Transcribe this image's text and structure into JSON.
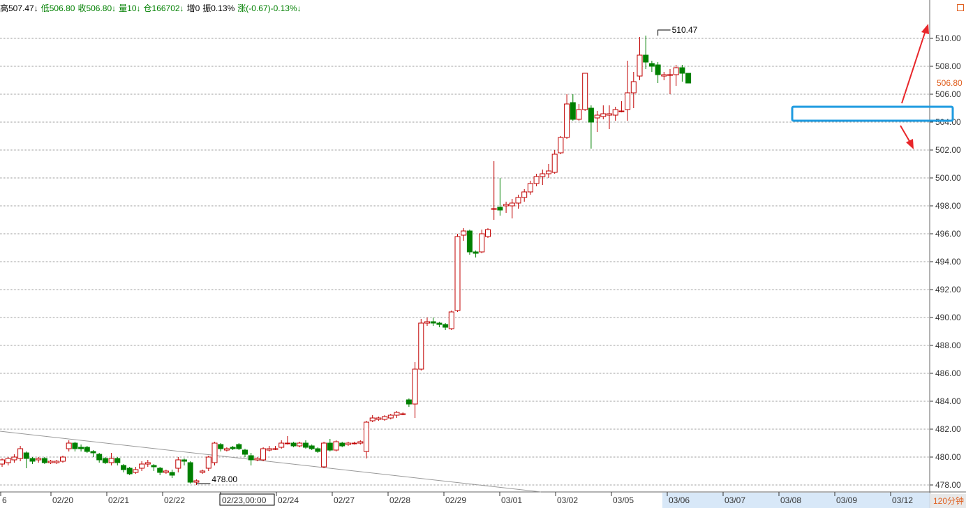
{
  "info_bar": {
    "high": "高507.47↓",
    "low": "低506.80",
    "close": "收506.80↓",
    "volume": "量10↓",
    "open_interest": "仓166702↓",
    "increase": "增0",
    "amplitude": "振0.13%",
    "change": "涨(-0.67)-0.13%↓"
  },
  "period_label": "120分钟",
  "colors": {
    "up": "#c00000",
    "down": "#008000",
    "grid": "#999999",
    "highlight": "#1e9be0",
    "arrow": "#e8262a",
    "axis_highlight": "#d8e8f8"
  },
  "chart_data": {
    "type": "candlestick",
    "ylim": [
      477.4,
      511.8
    ],
    "y_ticks": [
      478,
      480,
      482,
      484,
      486,
      488,
      490,
      492,
      494,
      496,
      498,
      500,
      502,
      504,
      506,
      508,
      510
    ],
    "last_price": "506.80",
    "x_labels": [
      "6",
      "02/20",
      "02/21",
      "02/22",
      "02/23,00:00",
      "02/24",
      "02/27",
      "02/28",
      "02/29",
      "03/01",
      "03/02",
      "03/05",
      "03/06",
      "03/07",
      "03/08",
      "03/09",
      "03/12"
    ],
    "crosshair_label": "02/23,00:00",
    "annotations": {
      "max_label": "510.47",
      "min_label": "478.00"
    },
    "highlight_zone": [
      504.1,
      505.1
    ],
    "candles": [
      [
        479.5,
        479.8,
        479.3,
        479.9
      ],
      [
        479.6,
        479.9,
        479.4,
        480.0
      ],
      [
        479.8,
        480.0,
        479.6,
        480.2
      ],
      [
        479.9,
        480.6,
        479.7,
        480.8
      ],
      [
        480.3,
        479.9,
        479.2,
        480.4
      ],
      [
        479.9,
        479.7,
        479.5,
        480.0
      ],
      [
        479.8,
        479.9,
        479.6,
        480.0
      ],
      [
        479.9,
        479.6,
        479.5,
        480.0
      ],
      [
        479.6,
        479.7,
        479.5,
        479.8
      ],
      [
        479.6,
        479.7,
        479.5,
        479.8
      ],
      [
        479.7,
        480.0,
        479.6,
        480.1
      ],
      [
        480.6,
        481.0,
        480.4,
        481.2
      ],
      [
        481.0,
        480.6,
        480.4,
        481.1
      ],
      [
        480.7,
        480.6,
        480.4,
        480.9
      ],
      [
        480.7,
        480.4,
        480.3,
        480.8
      ],
      [
        480.4,
        480.3,
        480.0,
        480.5
      ],
      [
        480.2,
        479.8,
        479.6,
        480.3
      ],
      [
        479.9,
        479.6,
        479.5,
        480.0
      ],
      [
        479.6,
        479.9,
        479.4,
        480.3
      ],
      [
        479.9,
        479.6,
        479.4,
        480.0
      ],
      [
        479.4,
        479.1,
        478.9,
        479.5
      ],
      [
        479.2,
        478.8,
        478.7,
        479.3
      ],
      [
        478.9,
        479.1,
        478.8,
        479.3
      ],
      [
        479.2,
        479.5,
        479.0,
        479.7
      ],
      [
        479.5,
        479.6,
        479.3,
        479.8
      ],
      [
        479.4,
        479.3,
        479.0,
        479.5
      ],
      [
        479.2,
        478.9,
        478.7,
        479.3
      ],
      [
        478.9,
        479.0,
        478.8,
        479.1
      ],
      [
        478.9,
        478.7,
        478.5,
        479.1
      ],
      [
        479.2,
        479.8,
        478.9,
        480.0
      ],
      [
        479.8,
        479.7,
        479.4,
        479.9
      ],
      [
        479.6,
        478.2,
        478.1,
        479.7
      ],
      [
        478.2,
        478.3,
        478.0,
        478.4
      ],
      [
        478.9,
        479.0,
        478.8,
        479.1
      ],
      [
        479.2,
        480.0,
        479.0,
        480.1
      ],
      [
        479.6,
        481.0,
        479.4,
        481.1
      ],
      [
        480.9,
        480.6,
        480.4,
        481.0
      ],
      [
        480.5,
        480.6,
        480.4,
        480.7
      ],
      [
        480.7,
        480.6,
        480.5,
        480.8
      ],
      [
        480.9,
        480.6,
        480.5,
        481.0
      ],
      [
        480.5,
        480.2,
        480.0,
        480.6
      ],
      [
        480.1,
        479.8,
        479.4,
        480.3
      ],
      [
        479.8,
        479.9,
        479.7,
        480.0
      ],
      [
        479.8,
        480.6,
        479.7,
        480.7
      ],
      [
        480.5,
        480.6,
        480.4,
        480.8
      ],
      [
        480.6,
        480.6,
        480.5,
        480.8
      ],
      [
        480.7,
        481.0,
        480.6,
        481.2
      ],
      [
        481.0,
        481.0,
        480.9,
        481.5
      ],
      [
        481.0,
        480.8,
        480.7,
        481.1
      ],
      [
        480.8,
        481.0,
        480.7,
        481.1
      ],
      [
        481.0,
        480.7,
        480.6,
        481.2
      ],
      [
        480.8,
        480.6,
        480.5,
        480.9
      ],
      [
        480.6,
        480.4,
        480.3,
        480.7
      ],
      [
        479.3,
        481.0,
        479.2,
        481.1
      ],
      [
        481.0,
        480.5,
        480.4,
        481.3
      ],
      [
        480.5,
        481.1,
        480.4,
        481.2
      ],
      [
        481.0,
        480.8,
        480.7,
        481.1
      ],
      [
        480.9,
        481.0,
        480.8,
        481.1
      ],
      [
        481.0,
        481.0,
        480.9,
        481.1
      ],
      [
        481.0,
        481.1,
        480.9,
        481.2
      ],
      [
        480.4,
        482.5,
        479.9,
        482.6
      ],
      [
        482.6,
        482.8,
        482.5,
        483.0
      ],
      [
        482.7,
        482.8,
        482.6,
        482.9
      ],
      [
        482.7,
        482.9,
        482.6,
        483.0
      ],
      [
        482.8,
        483.0,
        482.7,
        483.1
      ],
      [
        483.0,
        483.2,
        482.8,
        483.3
      ],
      [
        483.1,
        483.1,
        483.0,
        483.2
      ],
      [
        484.1,
        483.8,
        483.6,
        484.2
      ],
      [
        483.8,
        486.3,
        482.8,
        486.8
      ],
      [
        486.3,
        489.6,
        486.2,
        489.9
      ],
      [
        489.6,
        489.7,
        489.4,
        490.0
      ],
      [
        489.7,
        489.6,
        489.4,
        490.0
      ],
      [
        489.6,
        489.5,
        489.3,
        489.7
      ],
      [
        489.5,
        489.3,
        489.1,
        489.6
      ],
      [
        489.2,
        490.4,
        489.1,
        490.5
      ],
      [
        490.5,
        495.8,
        490.4,
        496.0
      ],
      [
        495.9,
        496.2,
        495.5,
        496.4
      ],
      [
        496.2,
        494.7,
        494.5,
        496.3
      ],
      [
        494.7,
        494.6,
        494.3,
        494.8
      ],
      [
        494.7,
        496.0,
        494.6,
        496.3
      ],
      [
        495.8,
        496.3,
        495.7,
        496.4
      ],
      [
        497.8,
        497.8,
        497.0,
        501.2
      ],
      [
        497.9,
        497.7,
        497.3,
        500.0
      ],
      [
        498.0,
        498.1,
        497.5,
        498.3
      ],
      [
        498.0,
        498.2,
        497.1,
        498.5
      ],
      [
        498.2,
        498.6,
        497.8,
        498.8
      ],
      [
        498.6,
        499.0,
        498.3,
        499.2
      ],
      [
        499.0,
        499.6,
        498.8,
        499.8
      ],
      [
        499.6,
        500.1,
        499.4,
        500.3
      ],
      [
        500.1,
        500.3,
        499.5,
        500.6
      ],
      [
        500.3,
        500.5,
        500.0,
        501.0
      ],
      [
        500.4,
        501.7,
        500.3,
        502.0
      ],
      [
        501.8,
        502.9,
        501.7,
        503.0
      ],
      [
        502.9,
        505.3,
        502.8,
        506.0
      ],
      [
        505.4,
        504.2,
        504.1,
        506.0
      ],
      [
        504.2,
        504.9,
        504.1,
        505.3
      ],
      [
        504.9,
        507.5,
        504.8,
        507.5
      ],
      [
        505.0,
        504.0,
        502.1,
        505.2
      ],
      [
        504.3,
        504.5,
        503.3,
        504.8
      ],
      [
        504.4,
        504.6,
        504.2,
        505.2
      ],
      [
        504.5,
        504.6,
        503.5,
        505.2
      ],
      [
        504.5,
        504.9,
        504.1,
        505.1
      ],
      [
        504.8,
        504.8,
        504.7,
        505.5
      ],
      [
        504.9,
        506.1,
        504.1,
        508.4
      ],
      [
        506.1,
        506.9,
        505.0,
        507.6
      ],
      [
        507.3,
        508.8,
        507.0,
        510.1
      ],
      [
        508.8,
        508.3,
        507.8,
        510.2
      ],
      [
        508.2,
        508.0,
        507.6,
        508.4
      ],
      [
        508.1,
        507.4,
        506.8,
        508.3
      ],
      [
        507.3,
        507.4,
        507.0,
        507.6
      ],
      [
        507.4,
        507.4,
        506.0,
        507.8
      ],
      [
        507.4,
        507.9,
        506.6,
        508.1
      ],
      [
        507.9,
        507.5,
        506.9,
        508.1
      ],
      [
        507.5,
        506.8,
        506.8,
        507.5
      ]
    ]
  }
}
